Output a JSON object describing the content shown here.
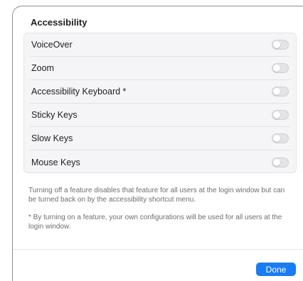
{
  "dialog": {
    "title": "Accessibility",
    "options": [
      {
        "label": "VoiceOver",
        "enabled": false
      },
      {
        "label": "Zoom",
        "enabled": false
      },
      {
        "label": "Accessibility Keyboard *",
        "enabled": false
      },
      {
        "label": "Sticky Keys",
        "enabled": false
      },
      {
        "label": "Slow Keys",
        "enabled": false
      },
      {
        "label": "Mouse Keys",
        "enabled": false
      }
    ],
    "note_disable": "Turning off a feature disables that feature for all users at the login window but can be turned back on by the accessibility shortcut menu.",
    "note_asterisk": "* By turning on a feature, your own configurations will be used for all users at the login window.",
    "done_label": "Done"
  },
  "colors": {
    "accent": "#1a7cf4",
    "toggle_off": "#e4e4e6",
    "group_background": "#f5f5f7"
  }
}
